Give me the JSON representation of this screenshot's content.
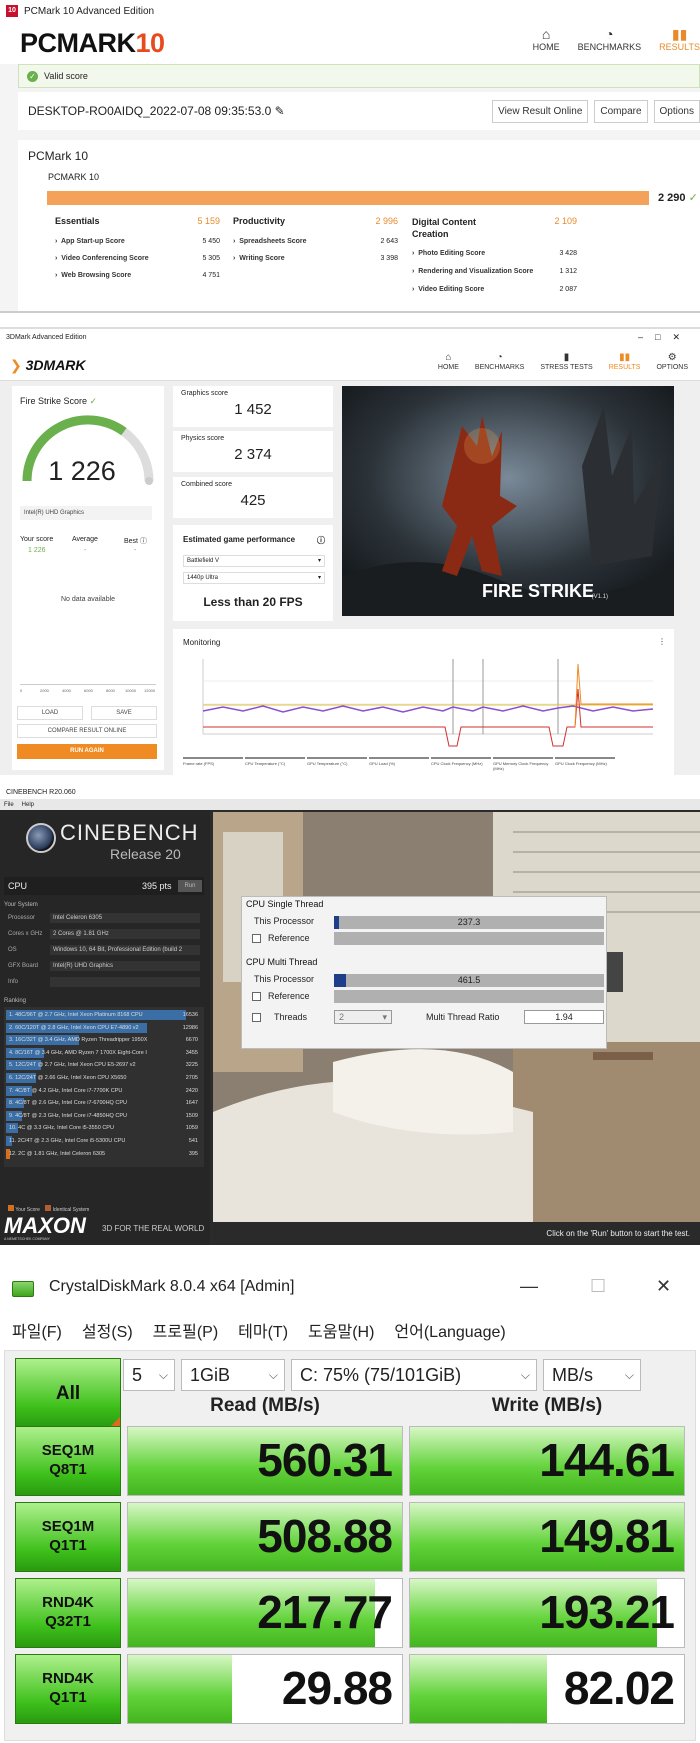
{
  "pcmark": {
    "window_title": "PCMark 10 Advanced Edition",
    "app_icon_text": "10",
    "logo_main": "PCMARK",
    "logo_num": "10",
    "nav": [
      {
        "icon": "home-icon",
        "label": "HOME"
      },
      {
        "icon": "benchmarks-icon",
        "label": "BENCHMARKS"
      },
      {
        "icon": "results-icon",
        "label": "RESULTS"
      }
    ],
    "valid_text": "Valid score",
    "result_name": "DESKTOP-RO0AIDQ_2022-07-08 09:35:53.0",
    "buttons": {
      "view_online": "View Result Online",
      "compare": "Compare",
      "options": "Options"
    },
    "section_title": "PCMark 10",
    "bench_name": "PCMARK 10",
    "total": "2 290",
    "groups": [
      {
        "name": "Essentials",
        "score": "5 159",
        "items": [
          {
            "name": "App Start-up Score",
            "score": "5 450"
          },
          {
            "name": "Video Conferencing Score",
            "score": "5 305"
          },
          {
            "name": "Web Browsing Score",
            "score": "4 751"
          }
        ]
      },
      {
        "name": "Productivity",
        "score": "2 996",
        "items": [
          {
            "name": "Spreadsheets Score",
            "score": "2 643"
          },
          {
            "name": "Writing Score",
            "score": "3 398"
          }
        ]
      },
      {
        "name": "Digital Content Creation",
        "score": "2 109",
        "items": [
          {
            "name": "Photo Editing Score",
            "score": "3 428"
          },
          {
            "name": "Rendering and Visualization Score",
            "score": "1 312"
          },
          {
            "name": "Video Editing Score",
            "score": "2 087"
          }
        ]
      }
    ]
  },
  "tdmark": {
    "window_title": "3DMark Advanced Edition",
    "logo_main": "3D",
    "logo_rest": "MARK",
    "nav": [
      {
        "icon": "home-icon",
        "label": "HOME"
      },
      {
        "icon": "benchmarks-icon",
        "label": "BENCHMARKS"
      },
      {
        "icon": "stress-tests-icon",
        "label": "STRESS TESTS"
      },
      {
        "icon": "results-icon",
        "label": "RESULTS"
      },
      {
        "icon": "options-icon",
        "label": "OPTIONS"
      }
    ],
    "fs_title": "Fire Strike Score",
    "fs_score": "1 226",
    "fs_score_fraction": 0.7,
    "gpu": "Intel(R) UHD Graphics",
    "compare_labels": {
      "yours": "Your score",
      "avg": "Average",
      "best": "Best"
    },
    "your_value": "1 226",
    "dash": "-",
    "no_data": "No data available",
    "axis_ticks": [
      "0",
      "2000",
      "4000",
      "6000",
      "8000",
      "10000",
      "12000"
    ],
    "buttons": {
      "load": "LOAD",
      "save": "SAVE",
      "compare": "COMPARE RESULT ONLINE",
      "run": "RUN AGAIN"
    },
    "scores": [
      {
        "label": "Graphics score",
        "value": "1 452"
      },
      {
        "label": "Physics score",
        "value": "2 374"
      },
      {
        "label": "Combined score",
        "value": "425"
      }
    ],
    "est_title": "Estimated game performance",
    "est_game": "Battlefield V",
    "est_res": "1440p Ultra",
    "est_fps": "Less than 20 FPS",
    "scene_title": "FIRE STRIKE",
    "scene_version": "(V1.1)",
    "monitoring_title": "Monitoring",
    "legend": [
      "Frame rate (FPS)",
      "CPU Temperature (°C)",
      "GPU Temperature (°C)",
      "GPU Load (%)",
      "CPU Clock Frequency (MHz)",
      "GPU Memory Clock Frequency (MHz)",
      "GPU Clock Frequency (MHz)"
    ],
    "legend_colors": [
      "#f08a23",
      "#6ab04c",
      "#3a8fd8",
      "#d0302e",
      "#8a4fd0",
      "#e0c040",
      "#e06aa0"
    ]
  },
  "cinebench": {
    "window_title": "CINEBENCH R20.060",
    "menu": [
      "File",
      "Help"
    ],
    "name": "CINEBENCH",
    "release": "Release 20",
    "cpu_label": "CPU",
    "cpu_score": "395 pts",
    "run_label": "Run",
    "your_system": "Your System",
    "system": [
      {
        "k": "Processor",
        "v": "Intel Celeron 6305"
      },
      {
        "k": "Cores x GHz",
        "v": "2 Cores @ 1.81 GHz"
      },
      {
        "k": "OS",
        "v": "Windows 10, 64 Bit, Professional Edition (build 2"
      },
      {
        "k": "GFX Board",
        "v": "Intel(R) UHD Graphics"
      },
      {
        "k": "Info",
        "v": ""
      }
    ],
    "ranking_title": "Ranking",
    "ranking": [
      {
        "t": "1. 48C/96T @ 2.7 GHz, Intel Xeon Platinum 8168 CPU",
        "s": "16536",
        "f": 1.0
      },
      {
        "t": "2. 60C/120T @ 2.8 GHz, Intel Xeon CPU E7-4890 v2",
        "s": "12986",
        "f": 0.785
      },
      {
        "t": "3. 16C/32T @ 3.4 GHz, AMD Ryzen Threadripper 1950X",
        "s": "6670",
        "f": 0.403
      },
      {
        "t": "4. 8C/16T @ 3.4 GHz, AMD Ryzen 7 1700X Eight-Core I",
        "s": "3455",
        "f": 0.209
      },
      {
        "t": "5. 12C/24T @ 2.7 GHz, Intel Xeon CPU E5-2697 v2",
        "s": "3225",
        "f": 0.195
      },
      {
        "t": "6. 12C/24T @ 2.66 GHz, Intel Xeon CPU X5650",
        "s": "2705",
        "f": 0.164
      },
      {
        "t": "7. 4C/8T @ 4.2 GHz, Intel Core i7-7700K CPU",
        "s": "2420",
        "f": 0.146
      },
      {
        "t": "8. 4C/8T @ 2.6 GHz, Intel Core i7-6700HQ CPU",
        "s": "1647",
        "f": 0.1
      },
      {
        "t": "9. 4C/8T @ 2.3 GHz, Intel Core i7-4850HQ CPU",
        "s": "1509",
        "f": 0.091
      },
      {
        "t": "10. 4C @ 3.3 GHz, Intel Core i5-3550 CPU",
        "s": "1059",
        "f": 0.064
      },
      {
        "t": "11. 2C/4T @ 2.3 GHz, Intel Core i5-5300U CPU",
        "s": "541",
        "f": 0.033
      },
      {
        "t": "12. 2C @ 1.81 GHz, Intel Celeron 6305",
        "s": "395",
        "f": 0.024
      }
    ],
    "legend_your": "Your Score",
    "legend_ident": "Identical System",
    "maxon": "MAXON",
    "maxon_sub": "A NEMETSCHEK COMPANY",
    "tagline": "3D FOR THE REAL WORLD",
    "footer_hint": "Click on the 'Run' button to start the test.",
    "single_title": "CPU Single Thread",
    "multi_title": "CPU Multi Thread",
    "this_processor": "This Processor",
    "reference": "Reference",
    "single_value": "237.3",
    "single_fraction": 0.018,
    "multi_value": "461.5",
    "multi_fraction": 0.045,
    "threads_label": "Threads",
    "threads_value": "2",
    "mtr_label": "Multi Thread Ratio",
    "mtr_value": "1.94"
  },
  "cdm": {
    "window_title": "CrystalDiskMark 8.0.4 x64 [Admin]",
    "menu": [
      "파일(F)",
      "설정(S)",
      "프로필(P)",
      "테마(T)",
      "도움말(H)",
      "언어(Language)"
    ],
    "all_label": "All",
    "count": "5",
    "size": "1GiB",
    "drive": "C: 75% (75/101GiB)",
    "unit": "MB/s",
    "read_header": "Read (MB/s)",
    "write_header": "Write (MB/s)",
    "rows": [
      {
        "l1": "SEQ1M",
        "l2": "Q8T1",
        "read": "560.31",
        "write": "144.61",
        "rf": 1.0,
        "wf": 1.0
      },
      {
        "l1": "SEQ1M",
        "l2": "Q1T1",
        "read": "508.88",
        "write": "149.81",
        "rf": 1.0,
        "wf": 1.0
      },
      {
        "l1": "RND4K",
        "l2": "Q32T1",
        "read": "217.77",
        "write": "193.21",
        "rf": 0.9,
        "wf": 0.9
      },
      {
        "l1": "RND4K",
        "l2": "Q1T1",
        "read": "29.88",
        "write": "82.02",
        "rf": 0.38,
        "wf": 0.5
      }
    ]
  }
}
